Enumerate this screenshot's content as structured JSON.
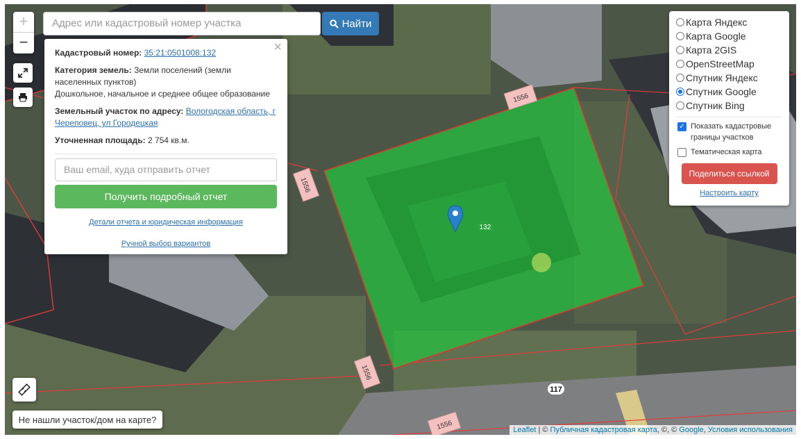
{
  "search": {
    "placeholder": "Адрес или кадастровый номер участка",
    "button_label": "Найти"
  },
  "zoom": {
    "plus": "+",
    "minus": "−"
  },
  "popup": {
    "close": "×",
    "cadastral_label": "Кадастровый номер:",
    "cadastral_number": "35:21:0501008:132",
    "category_label": "Категория земель:",
    "category_value": "Земли поселений (земли населенных пунктов)",
    "category_use": "Дошкольное, начальное и среднее общее образование",
    "address_label": "Земельный участок по адресу:",
    "address_value": "Вологодская область, г Череповец, ул Городецкая",
    "area_label": "Уточненная площадь:",
    "area_value": "2 754 кв.м.",
    "email_placeholder": "Ваш email, куда отправить отчет",
    "report_button": "Получить подробный отчет",
    "details_link": "Детали отчета и юридическая информация",
    "manual_link": "Ручной выбор вариантов"
  },
  "layers": {
    "options": [
      {
        "label": "Карта Яндекс",
        "selected": false
      },
      {
        "label": "Карта Google",
        "selected": false
      },
      {
        "label": "Карта 2GIS",
        "selected": false
      },
      {
        "label": "OpenStreetMap",
        "selected": false
      },
      {
        "label": "Спутник Яндекс",
        "selected": false
      },
      {
        "label": "Спутник Google",
        "selected": true
      },
      {
        "label": "Спутник Bing",
        "selected": false
      }
    ],
    "show_borders_label": "Показать кадастровые границы участков",
    "show_borders_checked": true,
    "thematic_label": "Тематическая карта",
    "thematic_checked": false,
    "share_button": "Поделиться ссылкой",
    "configure_link": "Настроить карту"
  },
  "map": {
    "parcel_labels": [
      "1556",
      "1556",
      "1556",
      "1556"
    ],
    "marker_label": "132",
    "road_label": "117",
    "parcel_color": "#22c33e"
  },
  "not_found_button": "Не нашли участок/дом на карте?",
  "attribution": {
    "leaflet": "Leaflet",
    "sep1": " | © ",
    "pkk": "Публичная кадастровая карта",
    "sep2": ", ©, © ",
    "google": "Google",
    "sep3": ", ",
    "terms": "Условия использования"
  }
}
